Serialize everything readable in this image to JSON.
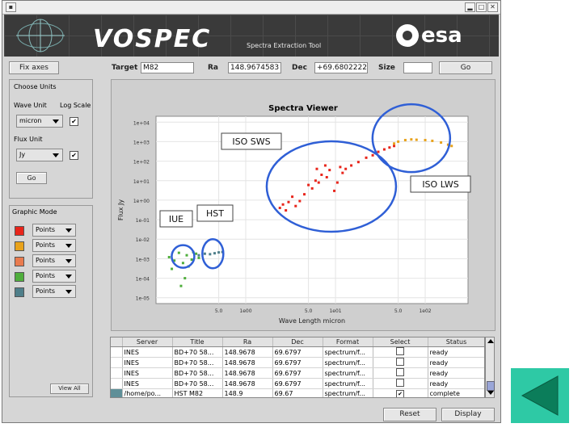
{
  "banner": {
    "logo": "VOSPEC",
    "subtitle": "Spectra Extraction Tool",
    "agency": "esa"
  },
  "toolbar": {
    "fix_axes": "Fix axes",
    "target_label": "Target",
    "target_value": "M82",
    "ra_label": "Ra",
    "ra_value": "148.9674583",
    "dec_label": "Dec",
    "dec_value": "+69.6802222",
    "size_label": "Size",
    "size_value": "",
    "go_label": "Go"
  },
  "units": {
    "heading": "Choose Units",
    "wave_unit_label": "Wave Unit",
    "log_scale_label": "Log Scale",
    "wave_unit_value": "micron",
    "wave_log_checked": "✔",
    "flux_unit_label": "Flux Unit",
    "flux_unit_value": "Jy",
    "flux_log_checked": "✔",
    "go_label": "Go"
  },
  "graphic_mode": {
    "heading": "Graphic Mode",
    "rows": [
      {
        "color": "#e8251b",
        "mode": "Points"
      },
      {
        "color": "#e8a21b",
        "mode": "Points"
      },
      {
        "color": "#e97b4e",
        "mode": "Points"
      },
      {
        "color": "#4fae3c",
        "mode": "Points"
      },
      {
        "color": "#4f7f8a",
        "mode": "Points"
      }
    ],
    "view_all": "View All"
  },
  "viewer": {
    "title": "Spectra Viewer",
    "annotations": {
      "iso_sws": "ISO SWS",
      "iso_lws": "ISO LWS",
      "iue": "IUE",
      "hst": "HST"
    }
  },
  "chart_data": {
    "type": "scatter",
    "title": "Spectra Viewer",
    "xlabel": "Wave Length micron",
    "ylabel": "Flux Jy",
    "x_log": true,
    "y_log": true,
    "xlim": [
      0.1,
      300
    ],
    "ylim": [
      5e-06,
      20000
    ],
    "grid": true,
    "x_ticks": [
      "5.0",
      "1e00",
      "5.0",
      "1e01",
      "5.0",
      "1e02"
    ],
    "y_ticks": [
      "1e+04",
      "1e+03",
      "1e+02",
      "1e+01",
      "1e+00",
      "1e-01",
      "1e-02",
      "1e-03",
      "1e-04",
      "1e-05"
    ],
    "series": [
      {
        "name": "IUE",
        "color": "#4fae3c",
        "points": [
          [
            0.14,
            0.0012
          ],
          [
            0.16,
            0.0008
          ],
          [
            0.18,
            0.002
          ],
          [
            0.2,
            0.0006
          ],
          [
            0.22,
            0.0015
          ],
          [
            0.25,
            0.0009
          ],
          [
            0.28,
            0.0018
          ],
          [
            0.3,
            0.0011
          ],
          [
            0.15,
            0.0003
          ],
          [
            0.19,
            4e-05
          ],
          [
            0.23,
            0.0004
          ],
          [
            0.26,
            0.0022
          ],
          [
            0.21,
            0.0001
          ]
        ]
      },
      {
        "name": "HST",
        "color": "#4f7f8a",
        "points": [
          [
            0.3,
            0.0015
          ],
          [
            0.35,
            0.0018
          ],
          [
            0.4,
            0.0017
          ],
          [
            0.45,
            0.0019
          ],
          [
            0.5,
            0.0021
          ],
          [
            0.55,
            0.0022
          ]
        ]
      },
      {
        "name": "ISO SWS",
        "color": "#e8251b",
        "points": [
          [
            2.4,
            0.4
          ],
          [
            2.6,
            0.6
          ],
          [
            2.8,
            0.3
          ],
          [
            3.0,
            0.8
          ],
          [
            3.3,
            1.5
          ],
          [
            3.6,
            0.5
          ],
          [
            4.0,
            0.9
          ],
          [
            4.5,
            2.0
          ],
          [
            5.0,
            6.0
          ],
          [
            5.5,
            4.0
          ],
          [
            6.0,
            10.0
          ],
          [
            6.2,
            40.0
          ],
          [
            6.5,
            8.0
          ],
          [
            7.0,
            20.0
          ],
          [
            7.7,
            60.0
          ],
          [
            8.0,
            15.0
          ],
          [
            8.6,
            35.0
          ],
          [
            9.7,
            3.0
          ],
          [
            10.5,
            8.0
          ],
          [
            11.3,
            50.0
          ],
          [
            12.0,
            25.0
          ],
          [
            13.0,
            40.0
          ],
          [
            15.0,
            60.0
          ],
          [
            18.0,
            90.0
          ],
          [
            22.0,
            150.0
          ],
          [
            26.0,
            200.0
          ],
          [
            30.0,
            300.0
          ],
          [
            35.0,
            400.0
          ],
          [
            40.0,
            500.0
          ],
          [
            45.0,
            600.0
          ]
        ]
      },
      {
        "name": "ISO LWS",
        "color": "#e8a21b",
        "points": [
          [
            45.0,
            800.0
          ],
          [
            50.0,
            1000.0
          ],
          [
            60.0,
            1200.0
          ],
          [
            70.0,
            1300.0
          ],
          [
            80.0,
            1250.0
          ],
          [
            100.0,
            1200.0
          ],
          [
            120.0,
            1100.0
          ],
          [
            150.0,
            900.0
          ],
          [
            180.0,
            700.0
          ],
          [
            197.0,
            600.0
          ]
        ]
      }
    ]
  },
  "results": {
    "headers": [
      "Server",
      "Title",
      "Ra",
      "Dec",
      "Format",
      "Select",
      "Status"
    ],
    "rows": [
      {
        "server": "INES",
        "title": "BD+70 58...",
        "ra": "148.9678",
        "dec": "69.6797",
        "format": "spectrum/f...",
        "select": "",
        "status": "ready"
      },
      {
        "server": "INES",
        "title": "BD+70 58...",
        "ra": "148.9678",
        "dec": "69.6797",
        "format": "spectrum/f...",
        "select": "",
        "status": "ready"
      },
      {
        "server": "INES",
        "title": "BD+70 58...",
        "ra": "148.9678",
        "dec": "69.6797",
        "format": "spectrum/f...",
        "select": "",
        "status": "ready"
      },
      {
        "server": "INES",
        "title": "BD+70 58...",
        "ra": "148.9678",
        "dec": "69.6797",
        "format": "spectrum/f...",
        "select": "",
        "status": "ready"
      },
      {
        "server": "/home/po...",
        "title": "HST M82",
        "ra": "148.9",
        "dec": "69.67",
        "format": "spectrum/f...",
        "select": "✔",
        "status": "complete"
      }
    ]
  },
  "footer": {
    "reset": "Reset",
    "display": "Display"
  },
  "colors": {
    "window_bg": "#d6d6d6",
    "nav_back": "#2ec9a5",
    "nav_arrow": "#0b7d5a",
    "annotation_ring": "#2f5fd6"
  }
}
